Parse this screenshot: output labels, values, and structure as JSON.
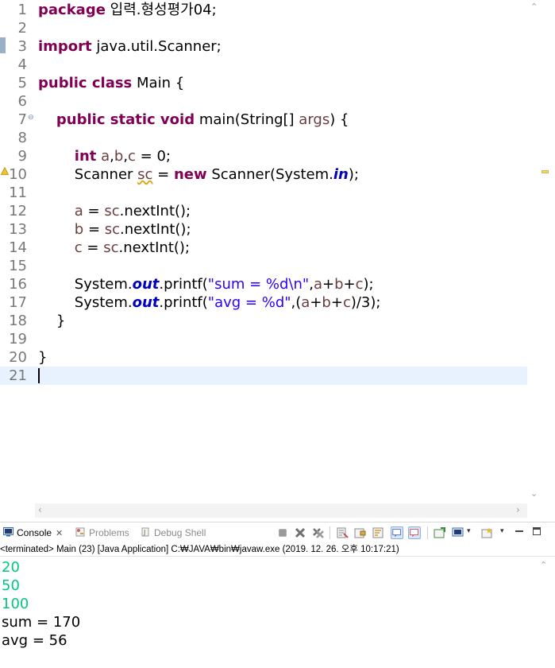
{
  "editor": {
    "lines": [
      {
        "n": "1",
        "seg": [
          {
            "c": "kw",
            "t": "package"
          },
          {
            "c": "",
            "t": " 입력.형성평가04;"
          }
        ]
      },
      {
        "n": "2",
        "seg": []
      },
      {
        "n": "3",
        "seg": [
          {
            "c": "kw",
            "t": "import"
          },
          {
            "c": "",
            "t": " java.util.Scanner;"
          }
        ]
      },
      {
        "n": "4",
        "seg": []
      },
      {
        "n": "5",
        "seg": [
          {
            "c": "kw",
            "t": "public class"
          },
          {
            "c": "",
            "t": " Main {"
          }
        ]
      },
      {
        "n": "6",
        "seg": []
      },
      {
        "n": "7",
        "seg": [
          {
            "c": "",
            "t": "    "
          },
          {
            "c": "kw",
            "t": "public static void"
          },
          {
            "c": "",
            "t": " main(String[] "
          },
          {
            "c": "var",
            "t": "args"
          },
          {
            "c": "",
            "t": ") {"
          }
        ]
      },
      {
        "n": "8",
        "seg": []
      },
      {
        "n": "9",
        "seg": [
          {
            "c": "",
            "t": "        "
          },
          {
            "c": "kw",
            "t": "int"
          },
          {
            "c": "",
            "t": " "
          },
          {
            "c": "var",
            "t": "a"
          },
          {
            "c": "",
            "t": ","
          },
          {
            "c": "var",
            "t": "b"
          },
          {
            "c": "",
            "t": ","
          },
          {
            "c": "var",
            "t": "c"
          },
          {
            "c": "",
            "t": " = 0;"
          }
        ]
      },
      {
        "n": "10",
        "seg": [
          {
            "c": "",
            "t": "        Scanner "
          },
          {
            "c": "var squig",
            "t": "sc"
          },
          {
            "c": "",
            "t": " = "
          },
          {
            "c": "kw",
            "t": "new"
          },
          {
            "c": "",
            "t": " Scanner(System."
          },
          {
            "c": "fld",
            "t": "in"
          },
          {
            "c": "",
            "t": ");"
          }
        ]
      },
      {
        "n": "11",
        "seg": []
      },
      {
        "n": "12",
        "seg": [
          {
            "c": "",
            "t": "        "
          },
          {
            "c": "var",
            "t": "a"
          },
          {
            "c": "",
            "t": " = "
          },
          {
            "c": "var",
            "t": "sc"
          },
          {
            "c": "",
            "t": ".nextInt();"
          }
        ]
      },
      {
        "n": "13",
        "seg": [
          {
            "c": "",
            "t": "        "
          },
          {
            "c": "var",
            "t": "b"
          },
          {
            "c": "",
            "t": " = "
          },
          {
            "c": "var",
            "t": "sc"
          },
          {
            "c": "",
            "t": ".nextInt();"
          }
        ]
      },
      {
        "n": "14",
        "seg": [
          {
            "c": "",
            "t": "        "
          },
          {
            "c": "var",
            "t": "c"
          },
          {
            "c": "",
            "t": " = "
          },
          {
            "c": "var",
            "t": "sc"
          },
          {
            "c": "",
            "t": ".nextInt();"
          }
        ]
      },
      {
        "n": "15",
        "seg": []
      },
      {
        "n": "16",
        "seg": [
          {
            "c": "",
            "t": "        System."
          },
          {
            "c": "fld",
            "t": "out"
          },
          {
            "c": "",
            "t": ".printf("
          },
          {
            "c": "str",
            "t": "\"sum = %d\\n\""
          },
          {
            "c": "",
            "t": ","
          },
          {
            "c": "var",
            "t": "a"
          },
          {
            "c": "",
            "t": "+"
          },
          {
            "c": "var",
            "t": "b"
          },
          {
            "c": "",
            "t": "+"
          },
          {
            "c": "var",
            "t": "c"
          },
          {
            "c": "",
            "t": ");"
          }
        ]
      },
      {
        "n": "17",
        "seg": [
          {
            "c": "",
            "t": "        System."
          },
          {
            "c": "fld",
            "t": "out"
          },
          {
            "c": "",
            "t": ".printf("
          },
          {
            "c": "str",
            "t": "\"avg = %d\""
          },
          {
            "c": "",
            "t": ",("
          },
          {
            "c": "var",
            "t": "a"
          },
          {
            "c": "",
            "t": "+"
          },
          {
            "c": "var",
            "t": "b"
          },
          {
            "c": "",
            "t": "+"
          },
          {
            "c": "var",
            "t": "c"
          },
          {
            "c": "",
            "t": ")/3);"
          }
        ]
      },
      {
        "n": "18",
        "seg": [
          {
            "c": "",
            "t": "    }"
          }
        ]
      },
      {
        "n": "19",
        "seg": []
      },
      {
        "n": "20",
        "seg": [
          {
            "c": "",
            "t": "}"
          }
        ]
      },
      {
        "n": "21",
        "seg": []
      }
    ],
    "current_line": "21"
  },
  "console": {
    "tabs": [
      {
        "label": "Console",
        "icon": "console-icon",
        "active": true
      },
      {
        "label": "Problems",
        "icon": "problems-icon",
        "active": false
      },
      {
        "label": "Debug Shell",
        "icon": "debug-shell-icon",
        "active": false
      }
    ],
    "status": "<terminated> Main (23) [Java Application] C:₩JAVA₩bin₩javaw.exe (2019. 12. 26. 오후 10:17:21)",
    "input_lines": [
      "20",
      "50",
      "100"
    ],
    "output_lines": [
      "sum = 170",
      "avg = 56"
    ]
  },
  "colors": {
    "keyword": "#7f0055",
    "string": "#2a00ff",
    "field": "#0000c0",
    "local_var": "#6a3e3e",
    "console_input": "#00c87d",
    "current_line_bg": "#e8f2fe"
  }
}
